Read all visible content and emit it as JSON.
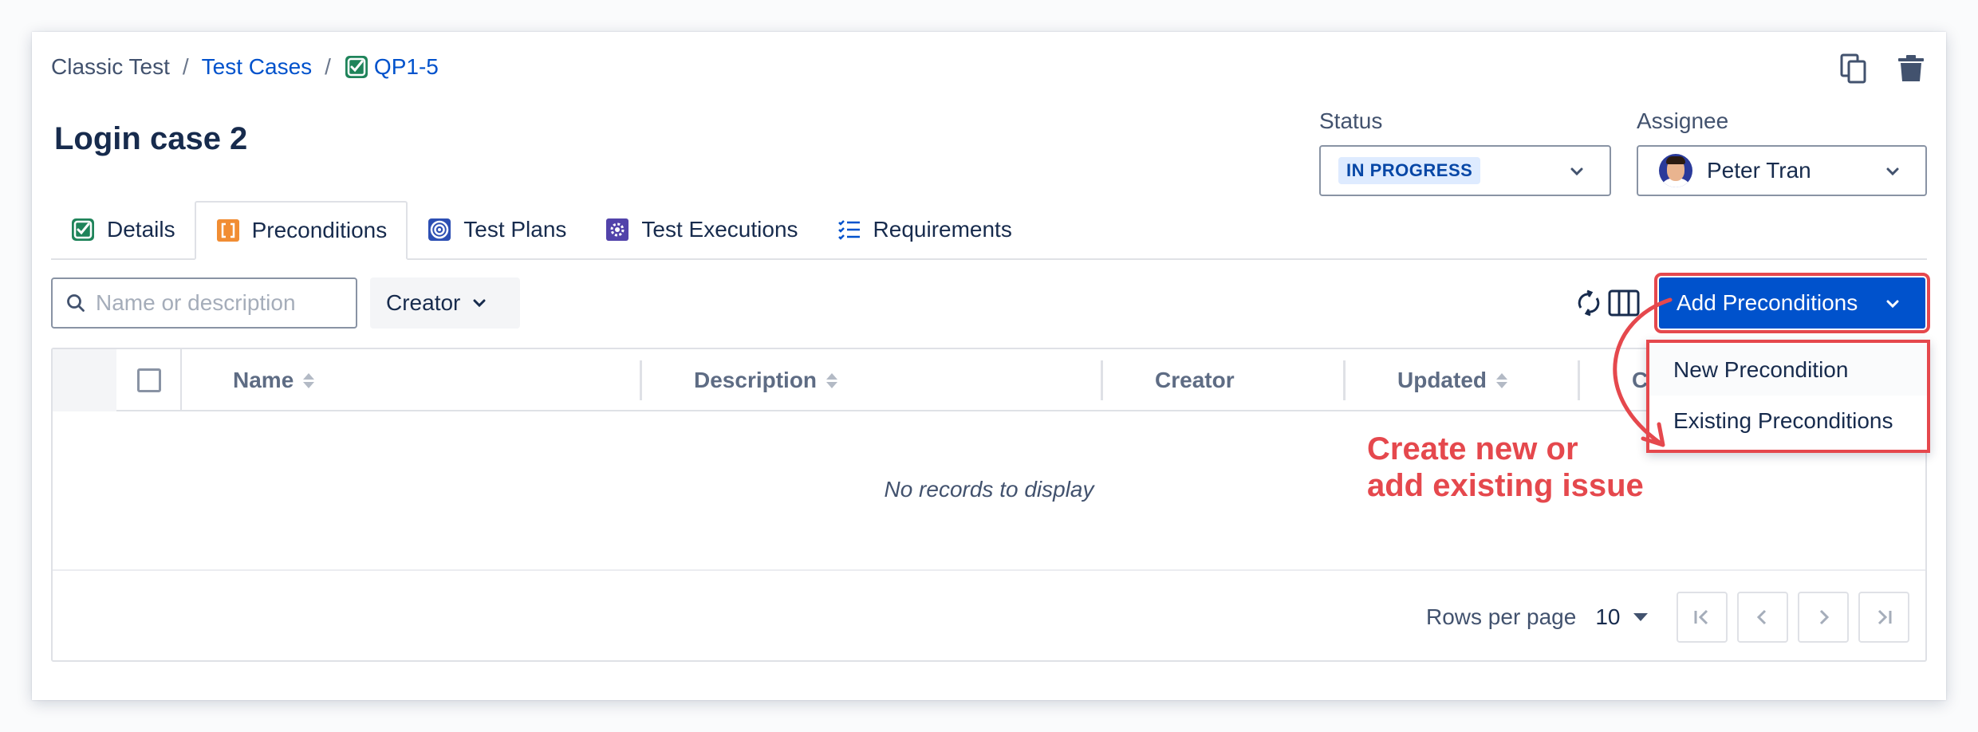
{
  "breadcrumb": {
    "project": "Classic Test",
    "sep1": "/",
    "section": "Test Cases",
    "sep2": "/",
    "issue_key": "QP1-5"
  },
  "top_actions": {
    "copy_icon": "copy-icon",
    "delete_icon": "trash-icon"
  },
  "title": "Login case 2",
  "status": {
    "label": "Status",
    "value": "IN PROGRESS"
  },
  "assignee": {
    "label": "Assignee",
    "name": "Peter Tran"
  },
  "tabs": [
    {
      "label": "Details",
      "icon": "check-square-icon"
    },
    {
      "label": "Preconditions",
      "icon": "brackets-icon",
      "active": true
    },
    {
      "label": "Test Plans",
      "icon": "target-icon"
    },
    {
      "label": "Test Executions",
      "icon": "gear-icon"
    },
    {
      "label": "Requirements",
      "icon": "checklist-icon"
    }
  ],
  "toolbar": {
    "search_placeholder": "Name or description",
    "creator_filter": "Creator",
    "add_button": "Add Preconditions"
  },
  "table": {
    "columns": [
      "Name",
      "Description",
      "Creator",
      "Updated",
      "C"
    ],
    "empty_message": "No records to display",
    "rows_per_page_label": "Rows per page",
    "rows_per_page_value": "10"
  },
  "dropdown": {
    "items": [
      "New Precondition",
      "Existing Preconditions"
    ]
  },
  "annotation": {
    "line1": "Create new or",
    "line2": "add existing issue"
  },
  "colors": {
    "primary": "#0052cc",
    "annotation": "#e5484d",
    "status_bg": "#deebff",
    "status_text": "#0747a6"
  }
}
